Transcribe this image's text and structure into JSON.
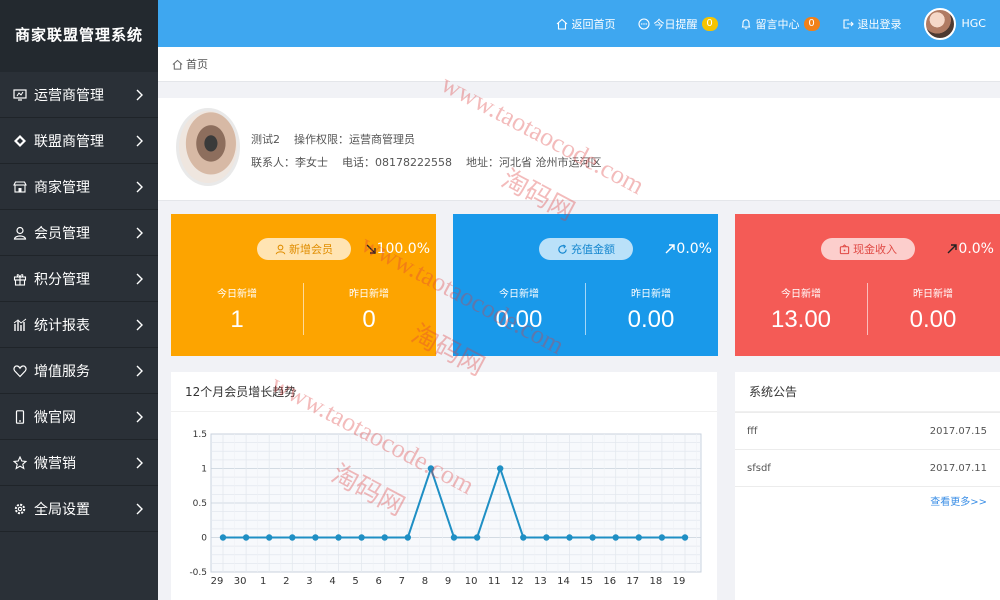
{
  "app": {
    "title": "商家联盟管理系统"
  },
  "sidebar": {
    "items": [
      {
        "label": "运营商管理",
        "icon": "monitor-icon"
      },
      {
        "label": "联盟商管理",
        "icon": "diamond-icon"
      },
      {
        "label": "商家管理",
        "icon": "store-icon"
      },
      {
        "label": "会员管理",
        "icon": "user-icon"
      },
      {
        "label": "积分管理",
        "icon": "gift-icon"
      },
      {
        "label": "统计报表",
        "icon": "chart-icon"
      },
      {
        "label": "增值服务",
        "icon": "heart-icon"
      },
      {
        "label": "微官网",
        "icon": "phone-icon"
      },
      {
        "label": "微营销",
        "icon": "star-icon"
      },
      {
        "label": "全局设置",
        "icon": "gear-icon"
      }
    ]
  },
  "topbar": {
    "home": "返回首页",
    "reminder": "今日提醒",
    "reminder_count": "0",
    "messages": "留言中心",
    "messages_count": "0",
    "logout": "退出登录",
    "username": "HGC"
  },
  "breadcrumb": {
    "home": "首页"
  },
  "profile": {
    "name": "测试2",
    "permission": "操作权限：运营商管理员",
    "contact": "联系人：李女士",
    "phone": "电话：08178222558",
    "address": "地址：河北省 沧州市运河区"
  },
  "cards": [
    {
      "pill": "新增会员",
      "trend": "100.0%",
      "trend_dir": "down",
      "today_label": "今日新增",
      "today": "1",
      "yesterday_label": "昨日新增",
      "yesterday": "0",
      "color": "#fda400"
    },
    {
      "pill": "充值金额",
      "trend": "0.0%",
      "trend_dir": "up",
      "today_label": "今日新增",
      "today": "0.00",
      "yesterday_label": "昨日新增",
      "yesterday": "0.00",
      "color": "#1999ea"
    },
    {
      "pill": "现金收入",
      "trend": "0.0%",
      "trend_dir": "up",
      "today_label": "今日新增",
      "today": "13.00",
      "yesterday_label": "昨日新增",
      "yesterday": "0.00",
      "color": "#f45b56"
    }
  ],
  "chart_panel": {
    "title": "12个月会员增长趋势"
  },
  "chart_data": {
    "type": "line",
    "title": "12个月会员增长趋势",
    "categories": [
      "29",
      "30",
      "1",
      "2",
      "3",
      "4",
      "5",
      "6",
      "7",
      "8",
      "9",
      "10",
      "11",
      "12",
      "13",
      "14",
      "15",
      "16",
      "17",
      "18",
      "19"
    ],
    "series": [
      {
        "values": [
          0,
          0,
          0,
          0,
          0,
          0,
          0,
          0,
          0,
          1,
          0,
          0,
          1,
          0,
          0,
          0,
          0,
          0,
          0,
          0,
          0
        ]
      }
    ],
    "y_ticks": [
      "1.5",
      "1",
      "0.5",
      "0",
      "-0.5"
    ],
    "ylim": [
      -0.5,
      1.5
    ],
    "grid": true,
    "line_color": "#1f8fc4"
  },
  "notice": {
    "title": "系统公告",
    "items": [
      {
        "text": "fff",
        "date": "2017.07.15"
      },
      {
        "text": "sfsdf",
        "date": "2017.07.11"
      }
    ],
    "more": "查看更多>>"
  },
  "watermark": {
    "url": "www.taotaocode.com",
    "cn": "淘码网"
  }
}
